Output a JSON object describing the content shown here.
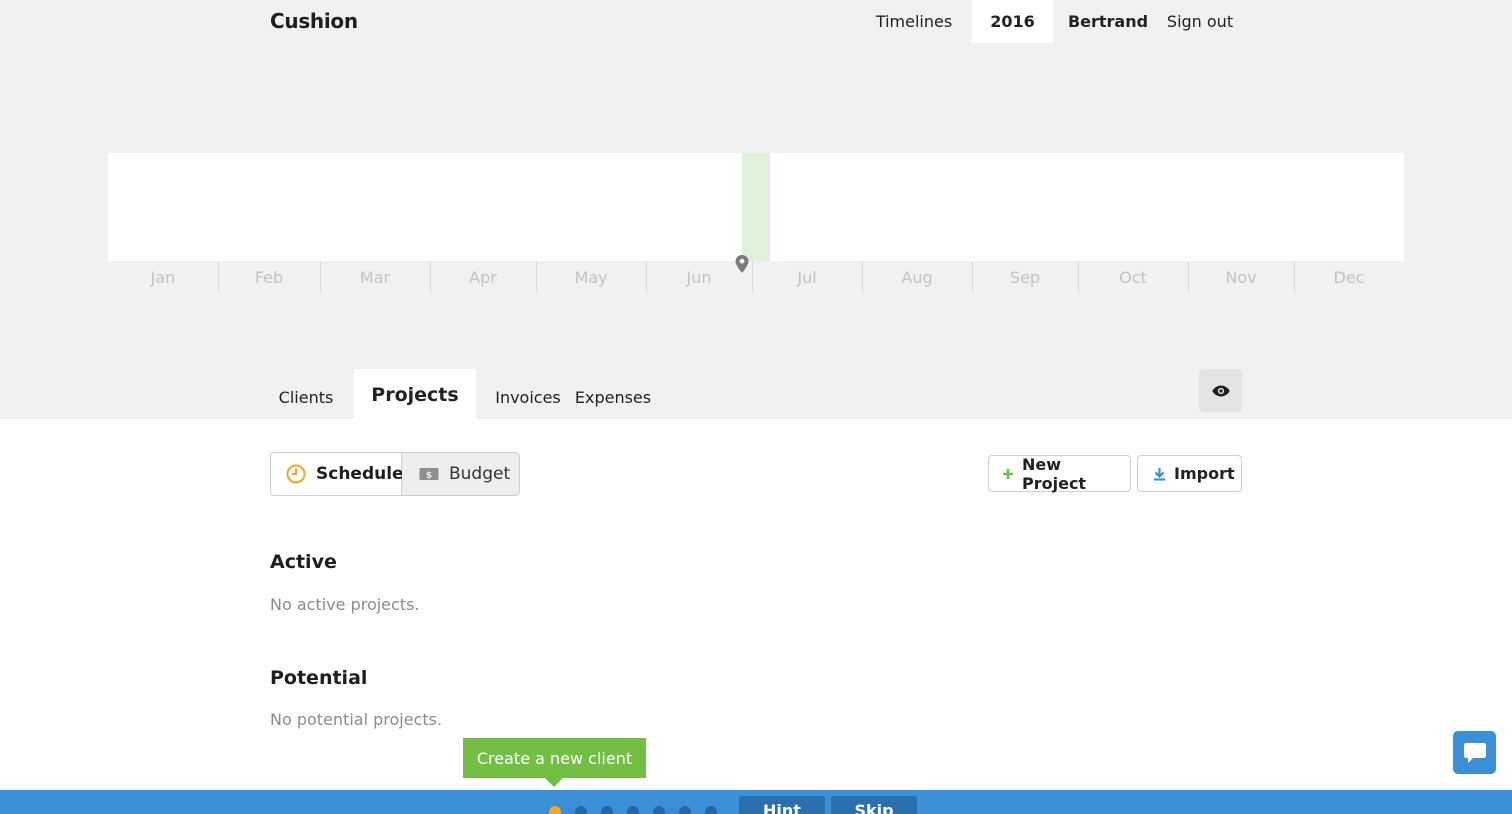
{
  "header": {
    "brand": "Cushion",
    "nav": {
      "timelines": "Timelines",
      "year": "2016",
      "user": "Bertrand",
      "sign_out": "Sign out"
    }
  },
  "timeline": {
    "months": [
      "Jan",
      "Feb",
      "Mar",
      "Apr",
      "May",
      "Jun",
      "Jul",
      "Aug",
      "Sep",
      "Oct",
      "Nov",
      "Dec"
    ],
    "today_marker_color": "#dff0db"
  },
  "tabs": {
    "clients": "Clients",
    "projects": "Projects",
    "invoices": "Invoices",
    "expenses": "Expenses",
    "active": "Projects",
    "visibility_icon": "eye-icon"
  },
  "view_toggle": {
    "schedule": "Schedule",
    "budget": "Budget",
    "selected": "Schedule",
    "schedule_icon": "clock-icon",
    "budget_icon": "dollar-bill-icon"
  },
  "actions": {
    "new_project": "New Project",
    "import": "Import"
  },
  "sections": {
    "active_title": "Active",
    "active_empty": "No active projects.",
    "potential_title": "Potential",
    "potential_empty": "No potential projects."
  },
  "onboarding": {
    "tooltip": "Create a new client",
    "hint": "Hint",
    "skip": "Skip",
    "steps_total": 7,
    "current_step": 1
  },
  "colors": {
    "accent_green": "#72bf44",
    "accent_blue": "#3a8fd6",
    "accent_orange": "#f5a623"
  }
}
